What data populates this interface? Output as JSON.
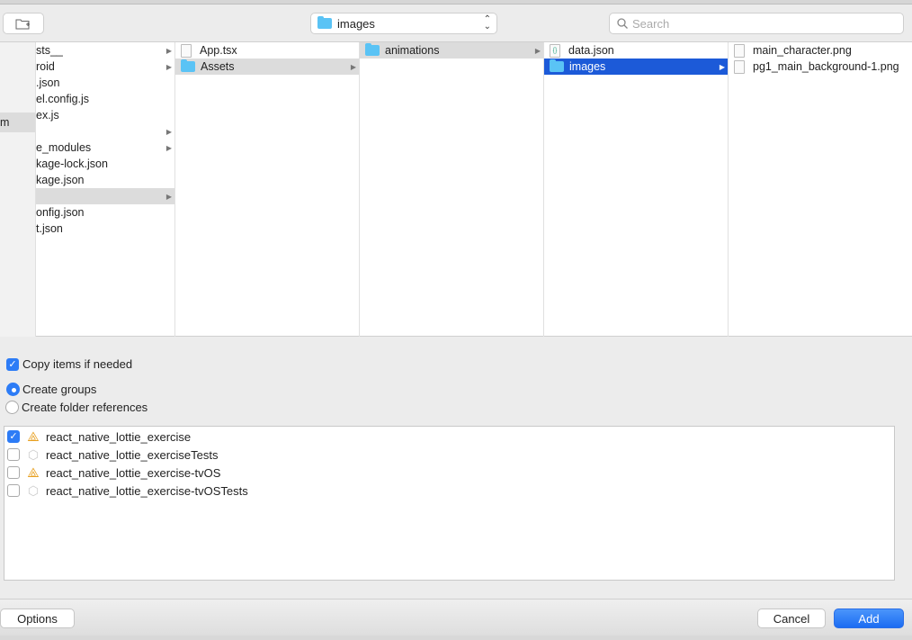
{
  "toolbar": {
    "path_selector": "images",
    "search_placeholder": "Search"
  },
  "sidebar": {
    "selected_item": "m"
  },
  "columns": [
    {
      "items": [
        {
          "name": "sts__",
          "folder": true
        },
        {
          "name": "roid",
          "folder": true
        },
        {
          "name": ".json"
        },
        {
          "name": "el.config.js"
        },
        {
          "name": "ex.js"
        },
        {
          "name": "",
          "folder": true
        },
        {
          "name": "e_modules",
          "folder": true
        },
        {
          "name": "kage-lock.json"
        },
        {
          "name": "kage.json"
        },
        {
          "name": "",
          "folder": true,
          "selected": true
        },
        {
          "name": "onfig.json"
        },
        {
          "name": "t.json"
        }
      ]
    },
    {
      "items": [
        {
          "name": "App.tsx",
          "icon": "file"
        },
        {
          "name": "Assets",
          "icon": "folder",
          "folder": true,
          "selected": true
        }
      ]
    },
    {
      "items": [
        {
          "name": "animations",
          "icon": "folder",
          "folder": true,
          "selected": true
        }
      ]
    },
    {
      "items": [
        {
          "name": "data.json",
          "icon": "file"
        },
        {
          "name": "images",
          "icon": "folder",
          "folder": true,
          "active": true
        }
      ]
    },
    {
      "items": [
        {
          "name": "main_character.png",
          "icon": "image"
        },
        {
          "name": "pg1_main_background-1.png",
          "icon": "image"
        }
      ]
    }
  ],
  "options": {
    "copy_items": {
      "label": "Copy items if needed",
      "checked": true
    },
    "create_groups": {
      "label": "Create groups",
      "selected": true
    },
    "create_folder_refs": {
      "label": "Create folder references",
      "selected": false
    }
  },
  "targets": [
    {
      "name": "react_native_lottie_exercise",
      "checked": true,
      "icon": "app-icon"
    },
    {
      "name": "react_native_lottie_exerciseTests",
      "checked": false,
      "icon": "test-bundle-icon"
    },
    {
      "name": "react_native_lottie_exercise-tvOS",
      "checked": false,
      "icon": "app-icon"
    },
    {
      "name": "react_native_lottie_exercise-tvOSTests",
      "checked": false,
      "icon": "test-bundle-icon"
    }
  ],
  "footer": {
    "options": "Options",
    "cancel": "Cancel",
    "add": "Add"
  },
  "colors": {
    "accent": "#2d7cf6",
    "selection": "#1c5ad8"
  }
}
